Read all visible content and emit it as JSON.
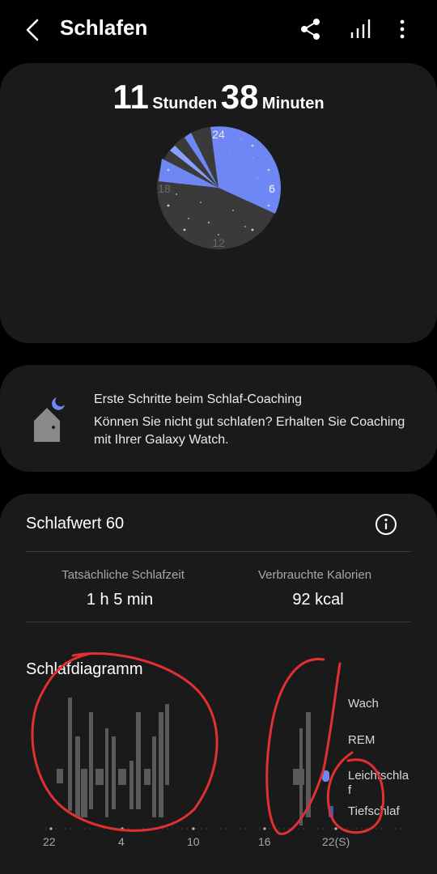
{
  "header": {
    "title": "Schlafen",
    "back_icon": "chevron-left-icon",
    "actions": [
      "share-icon",
      "bar-chart-icon",
      "more-vert-icon"
    ]
  },
  "summary": {
    "hours": "11",
    "hours_unit": "Stunden",
    "minutes": "38",
    "minutes_unit": "Minuten",
    "clock_labels": {
      "top": "24",
      "right": "6",
      "bottom": "12",
      "left": "18"
    },
    "colors": {
      "sleep_fill": "#6f86f5",
      "dial": "#3a3a3a"
    }
  },
  "coaching": {
    "icon": "moon-house-icon",
    "title": "Erste Schritte beim Schlaf-Coaching",
    "text": "Können Sie nicht gut schlafen? Erhalten Sie Coaching mit Ihrer Galaxy Watch."
  },
  "score": {
    "label": "Schlafwert 60",
    "info_icon": "info-icon"
  },
  "stats": [
    {
      "label": "Tatsächliche Schlafzeit",
      "value": "1 h 5 min"
    },
    {
      "label": "Verbrauchte Kalorien",
      "value": "92 kcal"
    }
  ],
  "diagram": {
    "title": "Schlafdiagramm",
    "legend": [
      "Wach",
      "REM",
      "Leichtschla\nf",
      "Tiefschlaf"
    ],
    "ticks": [
      "22",
      "4",
      "10",
      "16",
      "22(S)"
    ],
    "colors": {
      "light": "#6f86f5",
      "deep": "#2f5fb8",
      "annotation": "#e03030"
    }
  }
}
